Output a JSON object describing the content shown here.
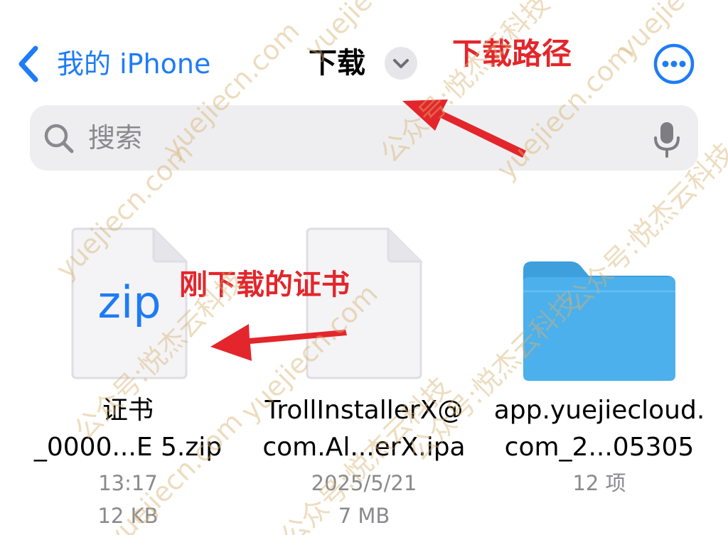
{
  "nav": {
    "back_label": "我的 iPhone",
    "title": "下载",
    "back_icon": "chevron-left-icon",
    "title_menu_icon": "chevron-down-icon",
    "more_icon": "ellipsis-circle-icon"
  },
  "search": {
    "placeholder": "搜索",
    "search_icon": "magnifier-icon",
    "mic_icon": "microphone-icon"
  },
  "files": [
    {
      "name_line1": "证书",
      "name_line2": "_0000...E 5.zip",
      "meta1": "13:17",
      "meta2": "12 KB",
      "icon_label": "zip",
      "icon": "document-icon"
    },
    {
      "name_line1": "TrollInstallerX@",
      "name_line2": "com.Al...erX.ipa",
      "meta1": "2025/5/21",
      "meta2": "7 MB",
      "icon": "document-icon"
    },
    {
      "name_line1": "app.yuejiecloud.",
      "name_line2": "com_2...05305",
      "meta1": "12 项",
      "icon": "folder-icon"
    }
  ],
  "annotations": {
    "download_path": "下载路径",
    "new_certificate": "刚下载的证书"
  },
  "watermark": {
    "text_a": "yuejiecn.com",
    "text_b": "公众号:悦杰云科技"
  },
  "colors": {
    "accent": "#1e7cf5",
    "annotation": "#e3262b",
    "folder": "#49aee8",
    "search_bg": "#eeeef0"
  }
}
